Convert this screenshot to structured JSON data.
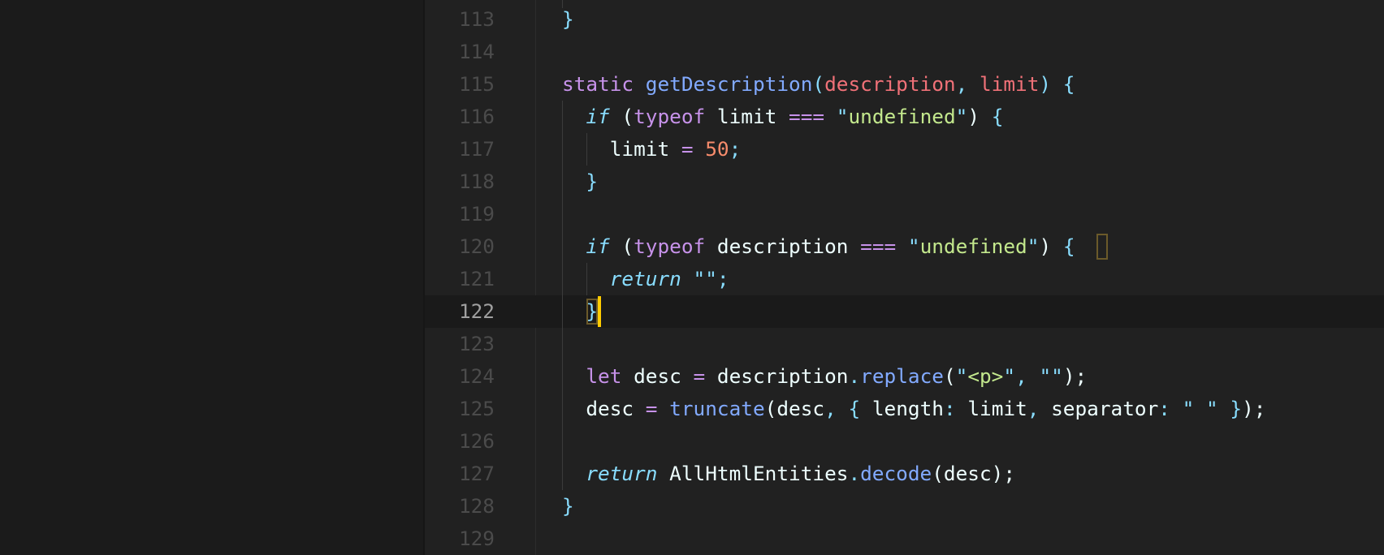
{
  "editor": {
    "language": "javascript",
    "theme": "Material Darker",
    "current_line": 122,
    "colors": {
      "background": "#212121",
      "keyword": "#c792ea",
      "control": "#89ddff",
      "function": "#82aaff",
      "parameter": "#f07178",
      "string": "#c3e88d",
      "number": "#f78c6c",
      "text": "#eeffff",
      "cursor": "#ffcc00"
    },
    "lines": [
      {
        "n": "113",
        "tokens": [
          {
            "t": "}",
            "c": "punc"
          }
        ]
      },
      {
        "n": "114",
        "tokens": []
      },
      {
        "n": "115",
        "tokens": [
          {
            "t": "static",
            "c": "k-purple"
          },
          {
            "t": " ",
            "c": "plain"
          },
          {
            "t": "getDescription",
            "c": "fn"
          },
          {
            "t": "(",
            "c": "punc"
          },
          {
            "t": "description",
            "c": "param"
          },
          {
            "t": ", ",
            "c": "punc"
          },
          {
            "t": "limit",
            "c": "param"
          },
          {
            "t": ")",
            "c": "punc"
          },
          {
            "t": " ",
            "c": "plain"
          },
          {
            "t": "{",
            "c": "punc"
          }
        ]
      },
      {
        "n": "116",
        "tokens": [
          {
            "t": "  ",
            "c": "plain"
          },
          {
            "t": "if",
            "c": "k-italic"
          },
          {
            "t": " (",
            "c": "plain"
          },
          {
            "t": "typeof",
            "c": "k-purple"
          },
          {
            "t": " limit ",
            "c": "plain"
          },
          {
            "t": "===",
            "c": "op"
          },
          {
            "t": " ",
            "c": "plain"
          },
          {
            "t": "\"",
            "c": "punc"
          },
          {
            "t": "undefined",
            "c": "str"
          },
          {
            "t": "\"",
            "c": "punc"
          },
          {
            "t": ") ",
            "c": "plain"
          },
          {
            "t": "{",
            "c": "punc"
          }
        ]
      },
      {
        "n": "117",
        "tokens": [
          {
            "t": "    limit ",
            "c": "plain"
          },
          {
            "t": "=",
            "c": "op"
          },
          {
            "t": " ",
            "c": "plain"
          },
          {
            "t": "50",
            "c": "num"
          },
          {
            "t": ";",
            "c": "punc"
          }
        ]
      },
      {
        "n": "118",
        "tokens": [
          {
            "t": "  ",
            "c": "plain"
          },
          {
            "t": "}",
            "c": "punc"
          }
        ]
      },
      {
        "n": "119",
        "tokens": []
      },
      {
        "n": "120",
        "tokens": [
          {
            "t": "  ",
            "c": "plain"
          },
          {
            "t": "if",
            "c": "k-italic"
          },
          {
            "t": " (",
            "c": "plain"
          },
          {
            "t": "typeof",
            "c": "k-purple"
          },
          {
            "t": " description ",
            "c": "plain"
          },
          {
            "t": "===",
            "c": "op"
          },
          {
            "t": " ",
            "c": "plain"
          },
          {
            "t": "\"",
            "c": "punc"
          },
          {
            "t": "undefined",
            "c": "str"
          },
          {
            "t": "\"",
            "c": "punc"
          },
          {
            "t": ") ",
            "c": "plain"
          },
          {
            "t": "{",
            "c": "punc"
          }
        ]
      },
      {
        "n": "121",
        "tokens": [
          {
            "t": "    ",
            "c": "plain"
          },
          {
            "t": "return",
            "c": "k-italic"
          },
          {
            "t": " ",
            "c": "plain"
          },
          {
            "t": "\"\"",
            "c": "punc"
          },
          {
            "t": ";",
            "c": "punc"
          }
        ]
      },
      {
        "n": "122",
        "tokens": [
          {
            "t": "  ",
            "c": "plain"
          },
          {
            "t": "}",
            "c": "punc"
          }
        ]
      },
      {
        "n": "123",
        "tokens": []
      },
      {
        "n": "124",
        "tokens": [
          {
            "t": "  ",
            "c": "plain"
          },
          {
            "t": "let",
            "c": "k-purple"
          },
          {
            "t": " desc ",
            "c": "plain"
          },
          {
            "t": "=",
            "c": "op"
          },
          {
            "t": " description",
            "c": "plain"
          },
          {
            "t": ".",
            "c": "punc"
          },
          {
            "t": "replace",
            "c": "fn"
          },
          {
            "t": "(",
            "c": "plain"
          },
          {
            "t": "\"",
            "c": "punc"
          },
          {
            "t": "<p>",
            "c": "str"
          },
          {
            "t": "\"",
            "c": "punc"
          },
          {
            "t": ", ",
            "c": "punc"
          },
          {
            "t": "\"\"",
            "c": "punc"
          },
          {
            "t": ");",
            "c": "plain"
          }
        ]
      },
      {
        "n": "125",
        "tokens": [
          {
            "t": "  desc ",
            "c": "plain"
          },
          {
            "t": "=",
            "c": "op"
          },
          {
            "t": " ",
            "c": "plain"
          },
          {
            "t": "truncate",
            "c": "fn"
          },
          {
            "t": "(desc",
            "c": "plain"
          },
          {
            "t": ", ",
            "c": "punc"
          },
          {
            "t": "{",
            "c": "punc"
          },
          {
            "t": " length",
            "c": "plain"
          },
          {
            "t": ":",
            "c": "punc"
          },
          {
            "t": " limit",
            "c": "plain"
          },
          {
            "t": ", ",
            "c": "punc"
          },
          {
            "t": "separator",
            "c": "plain"
          },
          {
            "t": ": ",
            "c": "punc"
          },
          {
            "t": "\" \"",
            "c": "punc"
          },
          {
            "t": " }",
            "c": "punc"
          },
          {
            "t": ");",
            "c": "plain"
          }
        ]
      },
      {
        "n": "126",
        "tokens": []
      },
      {
        "n": "127",
        "tokens": [
          {
            "t": "  ",
            "c": "plain"
          },
          {
            "t": "return",
            "c": "k-italic"
          },
          {
            "t": " AllHtmlEntities",
            "c": "plain"
          },
          {
            "t": ".",
            "c": "punc"
          },
          {
            "t": "decode",
            "c": "fn"
          },
          {
            "t": "(desc);",
            "c": "plain"
          }
        ]
      },
      {
        "n": "128",
        "tokens": [
          {
            "t": "}",
            "c": "punc"
          }
        ]
      },
      {
        "n": "129",
        "tokens": []
      }
    ]
  }
}
